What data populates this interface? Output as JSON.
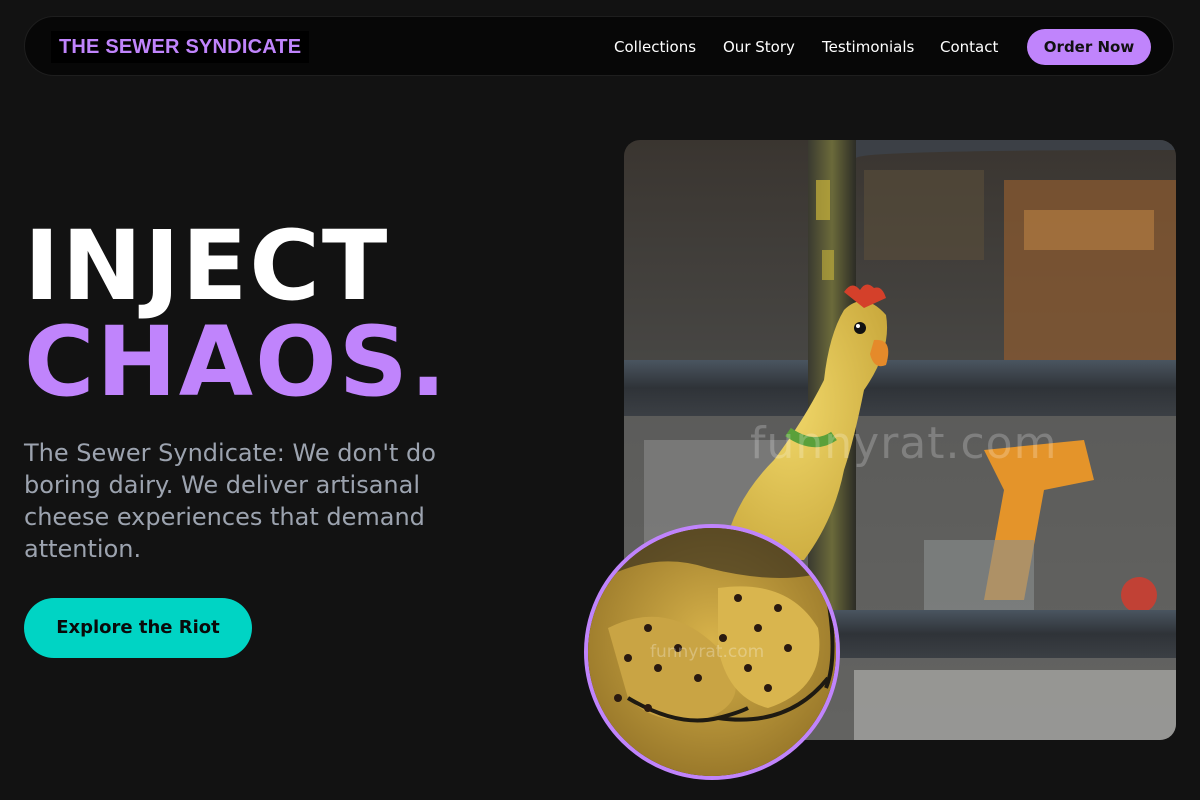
{
  "nav": {
    "brand": "THE SEWER SYNDICATE",
    "links": [
      "Collections",
      "Our Story",
      "Testimonials",
      "Contact"
    ],
    "cta": "Order Now"
  },
  "hero": {
    "headline_line1": "INJECT",
    "headline_line2": "CHAOS.",
    "subtitle": "The Sewer Syndicate: We don't do boring dairy. We deliver artisanal cheese experiences that demand attention.",
    "cta": "Explore the Riot"
  },
  "media": {
    "watermark": "funnyrat.com",
    "zoom_watermark": "funnyrat.com"
  },
  "colors": {
    "background": "#121212",
    "accent_purple": "#c084fc",
    "accent_teal": "#00d4c4",
    "muted_text": "#9ca3af"
  }
}
